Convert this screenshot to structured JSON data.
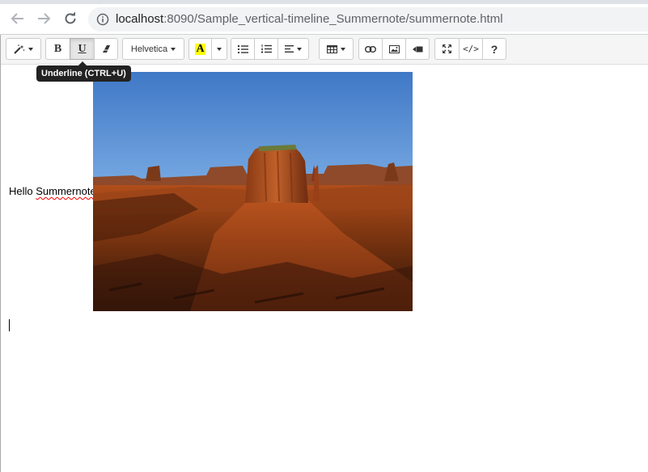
{
  "browser": {
    "url_host": "localhost",
    "url_rest": ":8090/Sample_vertical-timeline_Summernote/summernote.html",
    "icons": {
      "back": "arrow-left-icon",
      "forward": "arrow-right-icon",
      "reload": "reload-icon",
      "site_info": "info-icon"
    }
  },
  "toolbar": {
    "style_icon": "magic-wand-icon",
    "bold_label": "B",
    "underline_label": "U",
    "clear_icon": "eraser-icon",
    "font_name": "Helvetica",
    "color_label": "A",
    "color_highlight": "#ffff00",
    "ul_icon": "unordered-list-icon",
    "ol_icon": "ordered-list-icon",
    "paragraph_icon": "align-left-icon",
    "table_icon": "table-icon",
    "link_icon": "link-icon",
    "picture_icon": "picture-icon",
    "video_icon": "video-icon",
    "fullscreen_icon": "fullscreen-icon",
    "codeview_label": "</>",
    "help_label": "?"
  },
  "tooltip": {
    "text": "Underline (CTRL+U)"
  },
  "content": {
    "text_prefix": "Hello ",
    "text_misspelled": "Summernote",
    "image": "desert-mesa-photo"
  }
}
